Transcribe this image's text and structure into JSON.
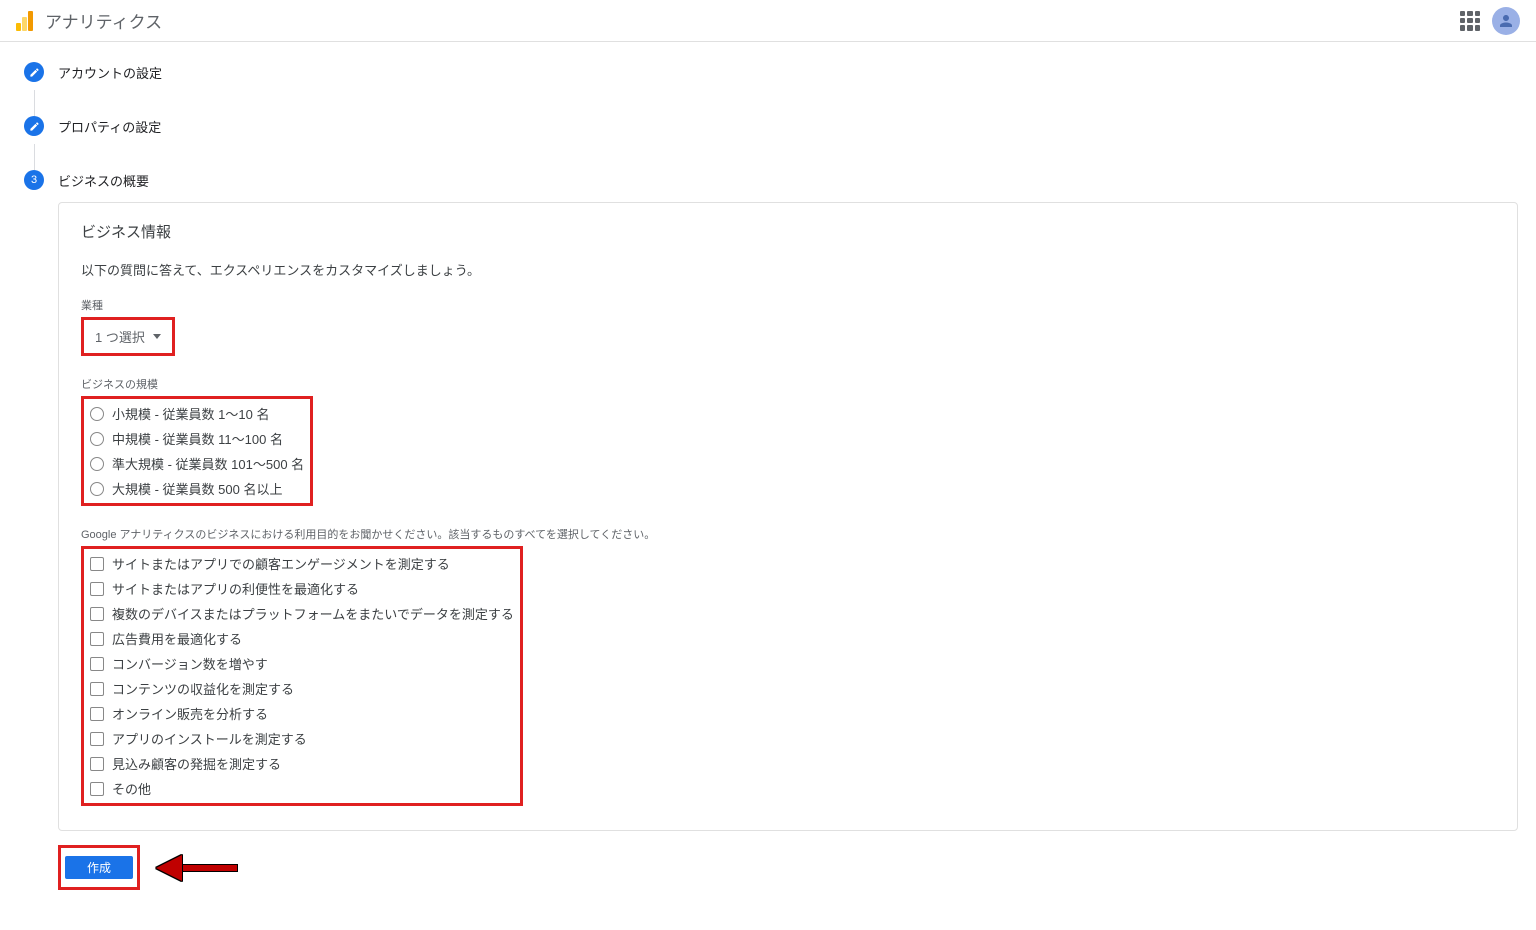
{
  "header": {
    "app_title": "アナリティクス"
  },
  "steps": [
    {
      "label": "アカウントの設定"
    },
    {
      "label": "プロパティの設定"
    },
    {
      "label": "ビジネスの概要",
      "number": "3"
    }
  ],
  "panel": {
    "title": "ビジネス情報",
    "subtitle": "以下の質問に答えて、エクスペリエンスをカスタマイズしましょう。",
    "industry": {
      "label": "業種",
      "select_text": "1 つ選択"
    },
    "size": {
      "label": "ビジネスの規模",
      "options": [
        "小規模 - 従業員数 1～10 名",
        "中規模 - 従業員数 11～100 名",
        "準大規模 - 従業員数 101～500 名",
        "大規模 - 従業員数 500 名以上"
      ]
    },
    "purpose": {
      "label": "Google アナリティクスのビジネスにおける利用目的をお聞かせください。該当するものすべてを選択してください。",
      "options": [
        "サイトまたはアプリでの顧客エンゲージメントを測定する",
        "サイトまたはアプリの利便性を最適化する",
        "複数のデバイスまたはプラットフォームをまたいでデータを測定する",
        "広告費用を最適化する",
        "コンバージョン数を増やす",
        "コンテンツの収益化を測定する",
        "オンライン販売を分析する",
        "アプリのインストールを測定する",
        "見込み顧客の発掘を測定する",
        "その他"
      ]
    }
  },
  "footer": {
    "create": "作成"
  }
}
